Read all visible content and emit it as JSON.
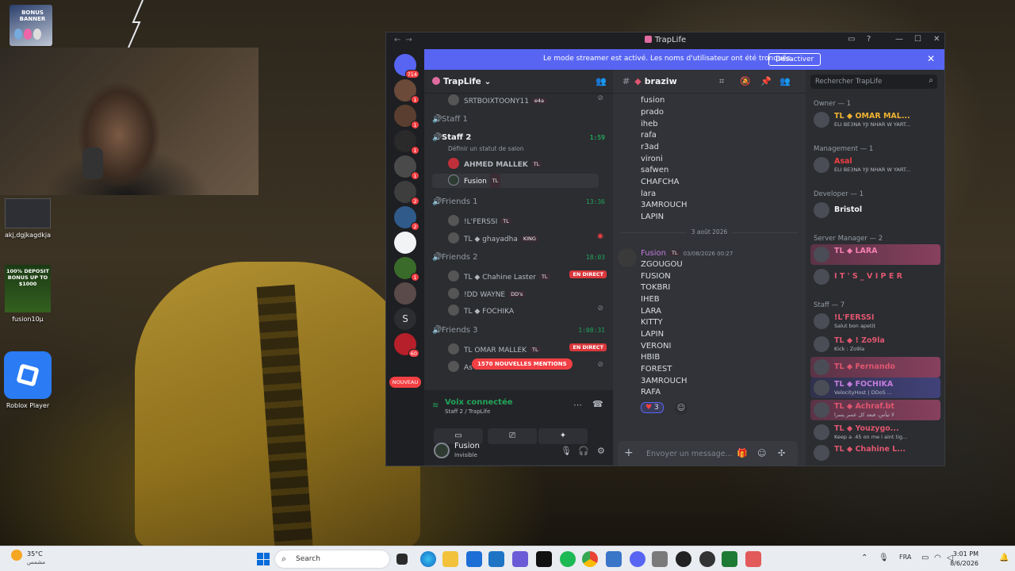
{
  "window": {
    "title": "TrapLife"
  },
  "banner": {
    "text": "Le mode streamer est activé. Les noms d'utilisateur ont été tronqués.",
    "button": "Désactiver"
  },
  "desktop_icons": [
    {
      "label": "BONUS BANNER"
    },
    {
      "label": "akj,dgjkagdkja"
    },
    {
      "label": "fusion10μ",
      "promo": "100% DEPOSIT BONUS UP TO $1000"
    },
    {
      "label": "Roblox Player"
    }
  ],
  "servers": {
    "top_badge": "714",
    "badges": [
      "1",
      "1",
      "1",
      "1",
      "1",
      "2",
      "2",
      "",
      "1",
      "",
      "",
      "60",
      "41"
    ],
    "text_server": "S",
    "nouveau": "NOUVEAU"
  },
  "server_name": "TrapLife",
  "channels": {
    "top_user": "SRTBOIXTOONY11",
    "top_user_tag": "e4a",
    "staff1": "Staff 1",
    "staff2": "Staff 2",
    "staff2_time": "1:59",
    "staff2_status": "Définir un statut de salon",
    "staff2_users": [
      {
        "name": "AHMED MALLEK",
        "tag": "TL"
      },
      {
        "name": "Fusion",
        "tag": "TL"
      }
    ],
    "friends1": "Friends 1",
    "friends1_time": "13:36",
    "friends1_users": [
      {
        "name": "!L'FERSSI",
        "tag": "TL"
      },
      {
        "name": "TL ◆ ghayadha",
        "tag": "KING"
      }
    ],
    "friends2": "Friends 2",
    "friends2_time": "18:03",
    "friends2_users": [
      {
        "name": "TL ◆ Chahine Laster",
        "tag": "TL",
        "live": "EN DIRECT"
      },
      {
        "name": "!DD WAYNE",
        "tag": "DD's"
      },
      {
        "name": "TL ◆ FOCHIKA",
        "tag": ""
      }
    ],
    "friends3": "Friends 3",
    "friends3_time": "1:08:31",
    "friends3_users": [
      {
        "name": "TL OMAR MALLEK",
        "tag": "TL",
        "live": "EN DIRECT"
      },
      {
        "name": "As",
        "tag": ""
      }
    ],
    "mentions": "1570 NOUVELLES MENTIONS"
  },
  "voice": {
    "status": "Voix connectée",
    "location": "Staff 2 / TrapLife"
  },
  "user": {
    "name": "Fusion",
    "status": "Invisible"
  },
  "chat": {
    "channel": "braziw",
    "first_lines": [
      "fusion",
      "prado",
      "iheb",
      "rafa",
      "r3ad",
      "vironi",
      "safwen",
      "CHAFCHA",
      "lara",
      "3AMROUCH",
      "LAPIN"
    ],
    "date": "3 août 2026",
    "author": "Fusion",
    "author_tag": "TL",
    "timestamp": "03/08/2026 00:27",
    "message_lines": [
      "ZGOUGOU",
      "FUSION",
      "TOKBRI",
      "IHEB",
      "LARA",
      "KITTY",
      "LAPIN",
      "VERONI",
      "HBIB",
      "FOREST",
      "3AMROUCH",
      "RAFA"
    ],
    "reaction_count": "3",
    "placeholder": "Envoyer un message..."
  },
  "members": {
    "search_placeholder": "Rechercher TrapLife",
    "groups": [
      {
        "role": "Owner — 1",
        "list": [
          {
            "name": "TL ◆ OMAR MAL...",
            "tag": "TL",
            "sub": "ELI BE3NA YJI NHAR W YART...",
            "color": "#f0b232"
          }
        ]
      },
      {
        "role": "Management — 1",
        "list": [
          {
            "name": "Asal",
            "tag": "TL",
            "sub": "ELI BE3NA YJI NHAR W YART...",
            "color": "#f23f43"
          }
        ]
      },
      {
        "role": "Developer — 1",
        "list": [
          {
            "name": "Bristol",
            "tag": "1",
            "sub": "",
            "color": "#f2f3f5"
          }
        ]
      },
      {
        "role": "Server Manager — 2",
        "list": [
          {
            "name": "TL ◆ LARA",
            "tag": "TL",
            "sub": "",
            "color": "#f47fb0"
          },
          {
            "name": "I T ' S _ V I P E R",
            "tag": "TL",
            "sub": "",
            "color": "#e0566f"
          }
        ]
      },
      {
        "role": "Staff — 7",
        "list": [
          {
            "name": "!L'FERSSI",
            "tag": "TL",
            "sub": "Salut bon apetit",
            "color": "#e0566f"
          },
          {
            "name": "TL ◆ ! Zo9la",
            "tag": "TL",
            "sub": "Kick : Zo9la",
            "color": "#e0566f"
          },
          {
            "name": "TL ◆ Fernando",
            "tag": "",
            "sub": "",
            "color": "#e0566f"
          },
          {
            "name": "TL ◆ FOCHIKA",
            "tag": "",
            "sub": "VelocityHost | DDoS ...",
            "color": "#c27cde"
          },
          {
            "name": "TL ◆ Achraf.bt",
            "tag": "TL",
            "sub": "لا تيأس، فبعد كل عسر يسرا",
            "color": "#e0566f"
          },
          {
            "name": "TL ◆ Youzygo...",
            "tag": "e4a",
            "sub": "Keep a .45 on me i aint tig...",
            "color": "#e0566f"
          },
          {
            "name": "TL ◆ Chahine L...",
            "tag": "TL",
            "sub": "",
            "color": "#e0566f"
          }
        ]
      }
    ]
  },
  "taskbar": {
    "temp": "35°C",
    "weather_desc": "مشمس",
    "search": "Search",
    "lang": "FRA",
    "time": "3:01 PM",
    "date": "8/6/2026"
  }
}
